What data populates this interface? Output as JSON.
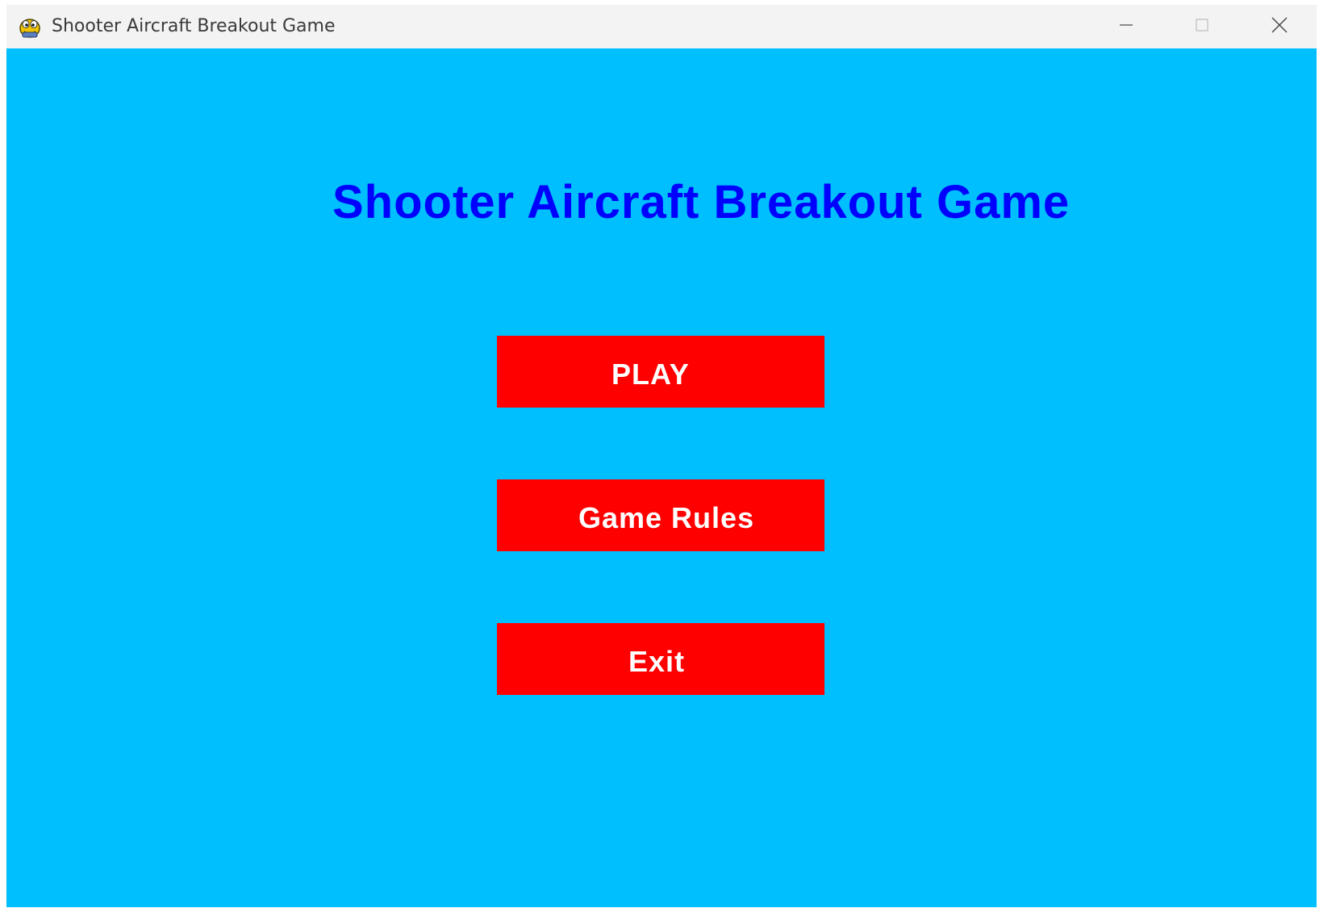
{
  "window": {
    "title": "Shooter Aircraft Breakout Game",
    "icon": "pygame-snake-icon",
    "controls": {
      "minimize_icon": "minimize-icon",
      "maximize_icon": "maximize-icon",
      "close_icon": "close-icon"
    }
  },
  "game": {
    "title": "Shooter Aircraft Breakout Game",
    "menu": {
      "play_label": "PLAY",
      "rules_label": "Game Rules",
      "exit_label": "Exit"
    }
  },
  "colors": {
    "background": "#00bfff",
    "title_text": "#0000ff",
    "button_fill": "#ff0000",
    "button_text": "#ffffff",
    "titlebar": "#f3f3f3"
  }
}
